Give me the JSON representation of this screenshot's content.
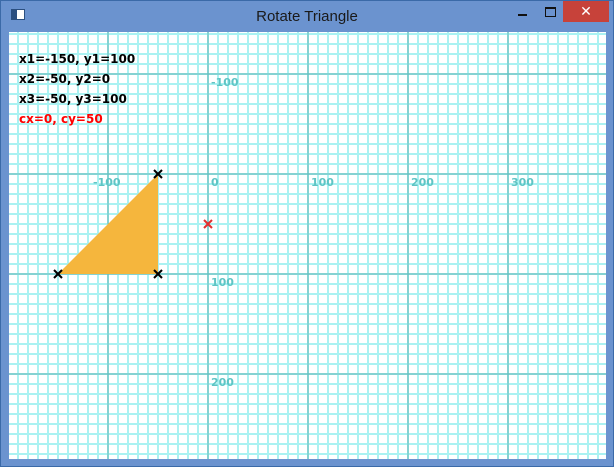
{
  "window": {
    "title": "Rotate Triangle",
    "close_glyph": "✕",
    "colors": {
      "titlebar": "#6b93cf",
      "close": "#c7423a"
    }
  },
  "canvas": {
    "colors": {
      "minor_grid": "#aaf2f2",
      "major_grid": "#5fb3b3",
      "axis_label": "#5fc4c4",
      "triangle": "#f5b63d",
      "vertex_marker": "#000000",
      "center_marker": "#e03030"
    },
    "units_per_minor_cell": 10,
    "x_ticks": [
      {
        "value": -100,
        "label": "-100"
      },
      {
        "value": 0,
        "label": "0"
      },
      {
        "value": 100,
        "label": "100"
      },
      {
        "value": 200,
        "label": "200"
      },
      {
        "value": 300,
        "label": "300"
      }
    ],
    "y_ticks": [
      {
        "value": -100,
        "label": "-100"
      },
      {
        "value": 100,
        "label": "100"
      },
      {
        "value": 200,
        "label": "200"
      }
    ],
    "triangle": [
      {
        "x": -150,
        "y": 100
      },
      {
        "x": -50,
        "y": 0
      },
      {
        "x": -50,
        "y": 100
      }
    ],
    "center": {
      "x": 0,
      "y": 50
    }
  },
  "info": {
    "line1": "x1=-150, y1=100",
    "line2": "x2=-50, y2=0",
    "line3": "x3=-50, y3=100",
    "center": "cx=0, cy=50"
  }
}
